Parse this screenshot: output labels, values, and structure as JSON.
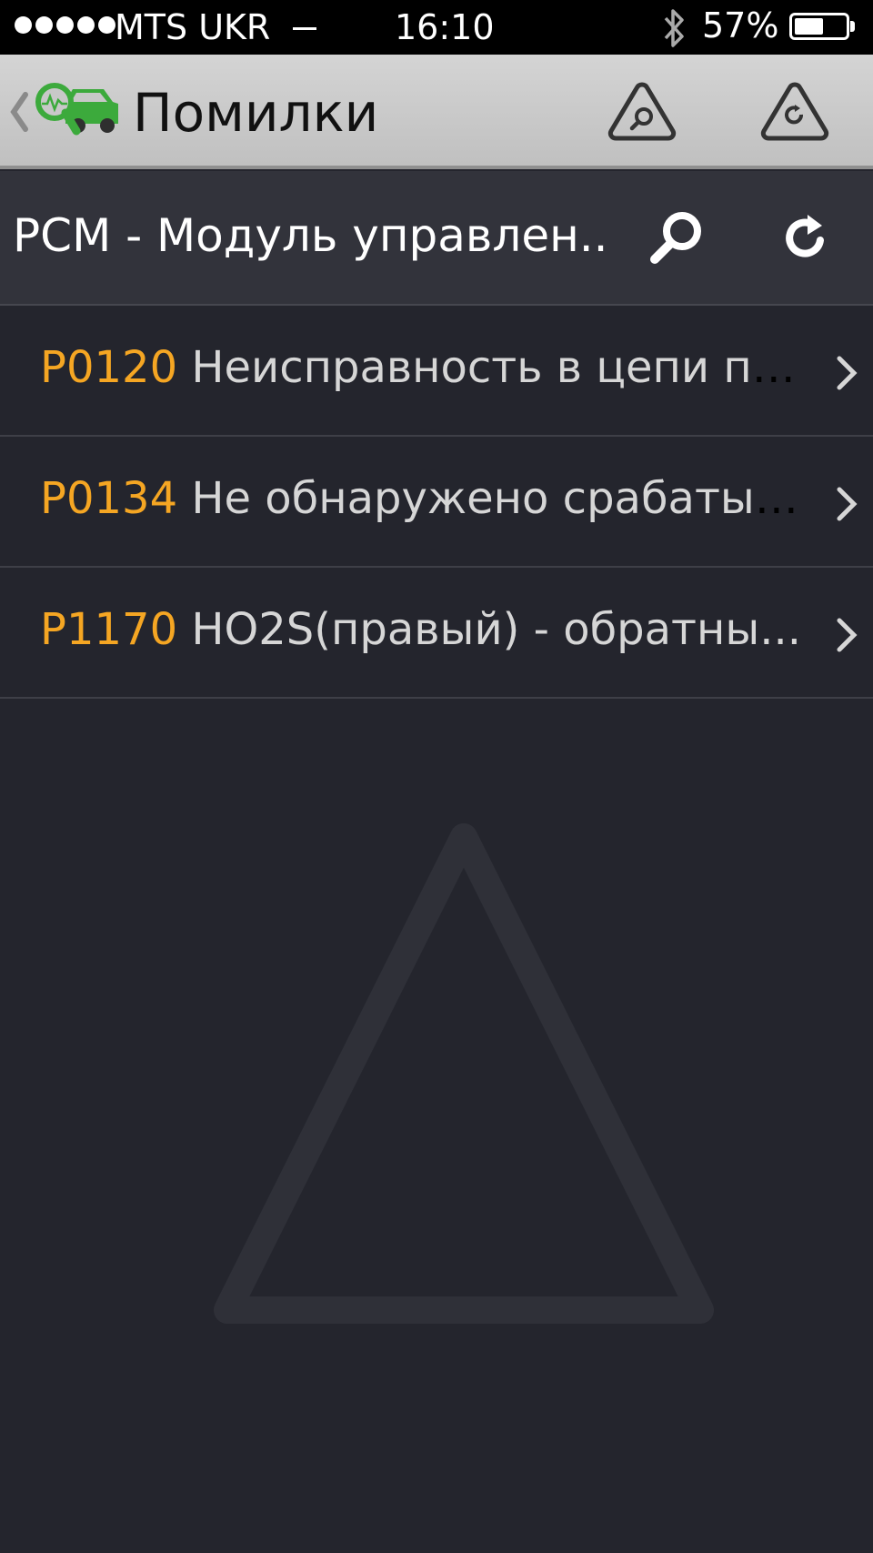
{
  "status_bar": {
    "carrier": "MTS UKR",
    "time": "16:10",
    "battery_percent": "57%",
    "battery_level": 0.57,
    "signal_dots": 5,
    "icons": [
      "signal-dots-icon",
      "wifi-icon",
      "bluetooth-icon",
      "battery-icon"
    ]
  },
  "header": {
    "title": "Помилки",
    "back_icon": "chevron-left-icon",
    "logo_icon": "car-diagnostics-logo-icon",
    "actions": [
      "warning-search-icon",
      "warning-reset-icon"
    ]
  },
  "module": {
    "title": "PCM - Модуль управлен...",
    "actions": [
      "search-icon",
      "refresh-icon"
    ]
  },
  "errors": [
    {
      "code": "P0120",
      "description": "Неисправность в цепи по..."
    },
    {
      "code": "P0134",
      "description": "Не обнаружено срабатыв..."
    },
    {
      "code": "P1170",
      "description": "HO2S(правый) - обратны..."
    }
  ],
  "colors": {
    "background": "#24252d",
    "header_bg": "#c8c8c8",
    "module_bar_bg": "#32333b",
    "error_code": "#f5a623",
    "error_text": "#d6d6d6",
    "logo_green": "#3caa3c"
  }
}
